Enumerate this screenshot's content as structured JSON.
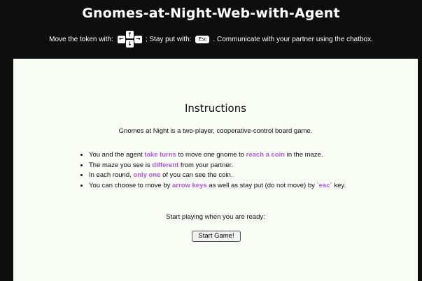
{
  "header": {
    "title": "Gnomes-at-Night-Web-with-Agent",
    "move_prefix": "Move the token with:",
    "stay_text": "; Stay put with:",
    "communicate_text": ". Communicate with your partner using the chatbox.",
    "keys": {
      "left": "←",
      "up": "↑",
      "down": "↓",
      "right": "→",
      "esc": "Esc"
    }
  },
  "instructions": {
    "title": "Instructions",
    "intro": "Gnomes at Night is a two-player, cooperative-control board game.",
    "rules": [
      {
        "parts": [
          "You and the agent ",
          "take turns",
          " to move one gnome to ",
          "reach a coin",
          " in the maze."
        ]
      },
      {
        "parts": [
          "The maze you see is ",
          "different",
          " from your partner."
        ]
      },
      {
        "parts": [
          "In each round, ",
          "only one",
          " of you can see the coin."
        ]
      },
      {
        "parts": [
          "You can choose to move by ",
          "arrow keys",
          " as well as stay put (do not move) by ",
          "`esc`",
          " key."
        ]
      }
    ],
    "start_prompt": "Start playing when you are ready:",
    "start_button": "Start Game!"
  },
  "colors": {
    "background": "#0e0e0e",
    "panel": "#f7fcf5",
    "highlight": "#b05cd8"
  }
}
